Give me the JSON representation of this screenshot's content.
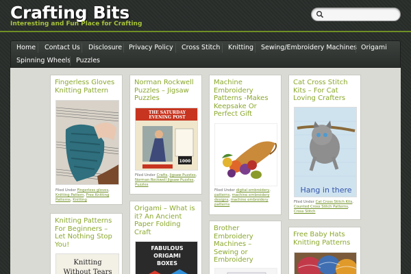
{
  "site": {
    "title": "Crafting Bits",
    "tagline": "Interesting and Fun Place for Crafting"
  },
  "search": {
    "placeholder": ""
  },
  "nav": {
    "items": [
      "Home",
      "Contact Us",
      "Disclosure",
      "Privacy Policy",
      "Cross Stitch",
      "Knitting",
      "Sewing/Embroidery Machines",
      "Origami",
      "Spinning Wheels",
      "Puzzles"
    ]
  },
  "posts": [
    {
      "title_lines": [
        "Fingerless Gloves",
        "Knitting Pattern"
      ],
      "filed_label": "Filed Under",
      "categories": [
        "Fingerless gloves",
        "Knitting Pattern",
        "Free Knitting Patterns",
        "Knitting"
      ]
    },
    {
      "title_lines": [
        "Norman Rockwell",
        "Puzzles – Jigsaw",
        "Puzzles"
      ],
      "filed_label": "Filed Under",
      "categories": [
        "Crafts",
        "Jigsaw Puzzles",
        "Norman Rockwell Jigsaw Puzzles",
        "Puzzles"
      ],
      "image_text": {
        "line1": "THE SATURDAY",
        "line2": "EVENING POST",
        "badge": "1000"
      }
    },
    {
      "title_lines": [
        "Machine",
        "Embroidery",
        "Patterns -Makes",
        "Keepsake Or",
        "Perfect Gift"
      ],
      "filed_label": "Filed Under",
      "categories": [
        "digital embroidery",
        "patterns",
        "machine embroidery designs",
        "machine embroidery patterns"
      ]
    },
    {
      "title_lines": [
        "Cat Cross Stitch",
        "Kits – For Cat",
        "Loving Crafters"
      ],
      "filed_label": "Filed Under",
      "categories": [
        "Cat Cross Stitch Kits",
        "Counted Cross Stitch Patterns",
        "Cross Stitch"
      ],
      "image_text": {
        "caption": "Hang in there"
      }
    },
    {
      "title_lines": [
        "Origami – What is",
        "it? An Ancient",
        "Paper Folding",
        "Craft"
      ],
      "image_text": {
        "line1": "FABULOUS",
        "line2": "ORIGAMI",
        "line3": "BOXES"
      }
    },
    {
      "title_lines": [
        "Knitting Patterns",
        "For Beginners –",
        "Let Nothing Stop",
        "You!"
      ],
      "image_text": {
        "line1": "Knitting",
        "line2": "Without Tears"
      }
    },
    {
      "title_lines": [
        "Brother",
        "Embroidery",
        "Machines –",
        "Sewing or",
        "Embroidery"
      ]
    },
    {
      "title_lines": [
        "Free Baby Hats",
        "Knitting Patterns"
      ]
    }
  ],
  "colors": {
    "accent": "#8aa82c",
    "background": "#2b2f2c",
    "content": "#d9dad3"
  }
}
